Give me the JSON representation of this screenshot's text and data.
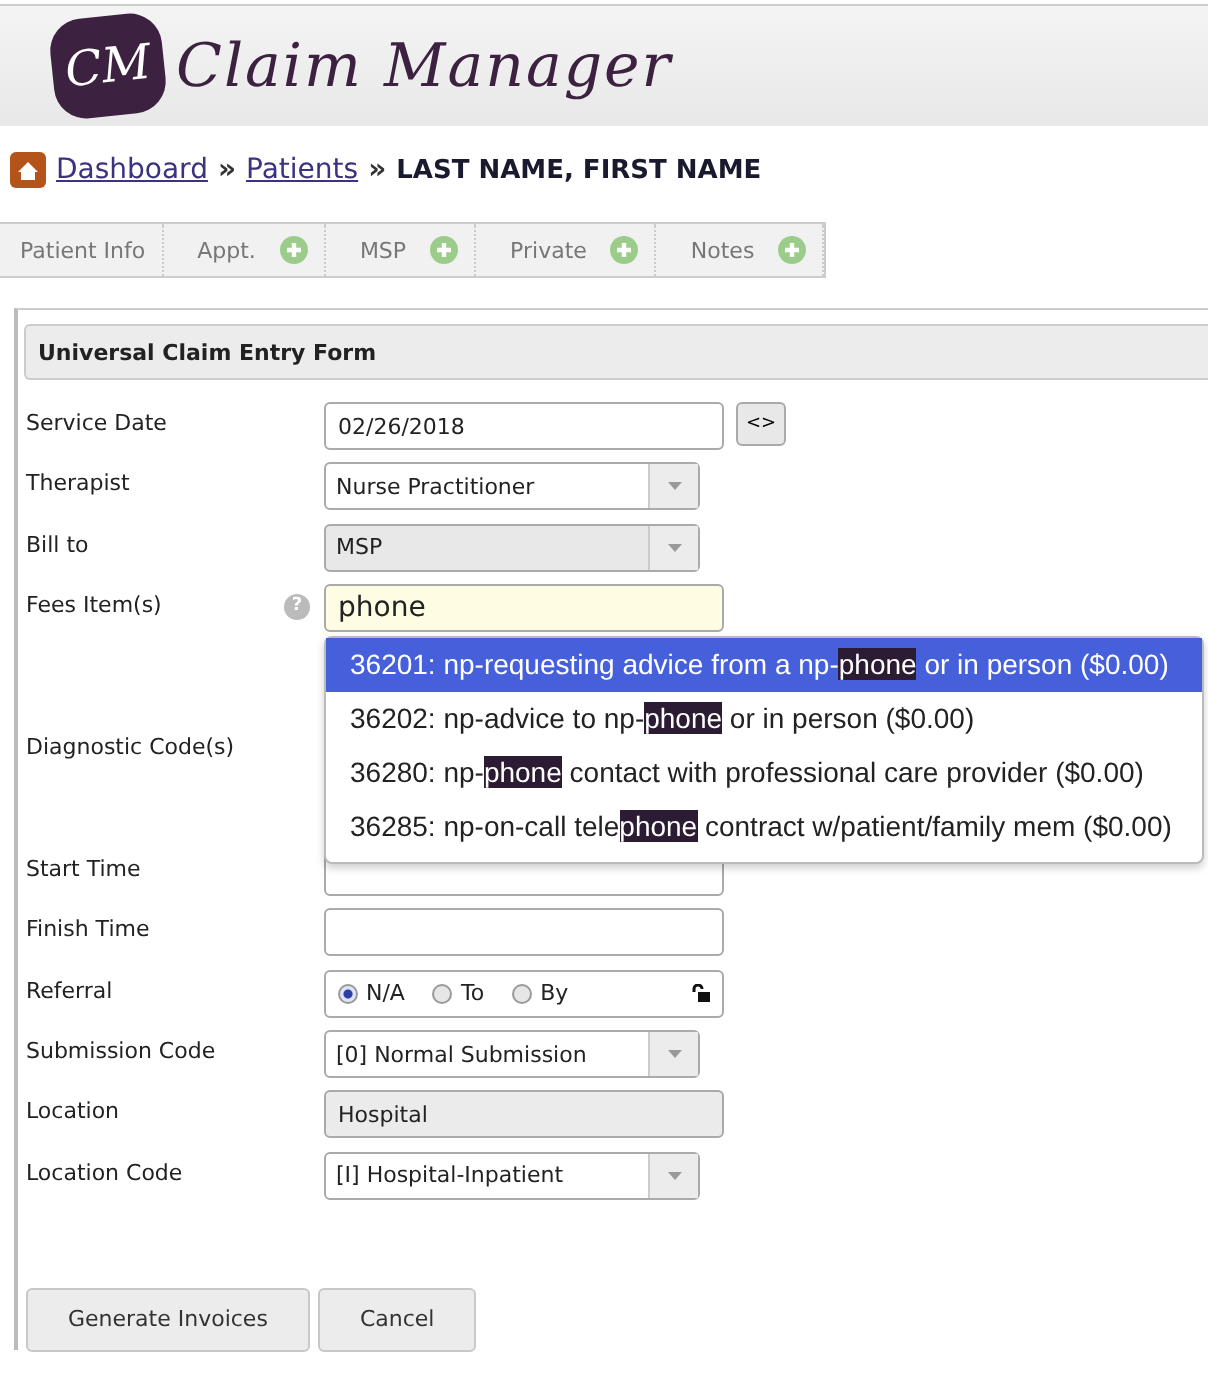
{
  "header": {
    "logo_mark": "CM",
    "title": "Claim Manager"
  },
  "breadcrumb": {
    "links": [
      "Dashboard",
      "Patients"
    ],
    "separators": [
      "»",
      "»"
    ],
    "current": "LAST NAME, FIRST NAME"
  },
  "tabs": [
    {
      "label": "Patient Info",
      "add_button": false
    },
    {
      "label": "Appt.",
      "add_button": true
    },
    {
      "label": "MSP",
      "add_button": true
    },
    {
      "label": "Private",
      "add_button": true
    },
    {
      "label": "Notes",
      "add_button": true
    }
  ],
  "form": {
    "title": "Universal Claim Entry Form",
    "fields": [
      {
        "kind": "date",
        "label": "Service Date",
        "value": "02/26/2018",
        "button": "<>"
      },
      {
        "kind": "select",
        "label": "Therapist",
        "value": "Nurse Practitioner",
        "disabled": false
      },
      {
        "kind": "select",
        "label": "Bill to",
        "value": "MSP",
        "disabled": true
      },
      {
        "kind": "text",
        "label": "Fees Item(s)",
        "value": "phone",
        "help": "?",
        "focused": true,
        "readonly": false
      },
      {
        "kind": "code",
        "label": "Diagnostic Code(s)"
      },
      {
        "kind": "text",
        "label": "Start Time",
        "focused": false,
        "readonly": false
      },
      {
        "kind": "text",
        "label": "Finish Time",
        "focused": false,
        "readonly": false
      },
      {
        "kind": "radio",
        "label": "Referral",
        "options": [
          {
            "label": "N/A",
            "selected": true
          },
          {
            "label": "To",
            "selected": false
          },
          {
            "label": "By",
            "selected": false
          }
        ]
      },
      {
        "kind": "select",
        "label": "Submission Code",
        "value": "[0] Normal Submission",
        "disabled": false
      },
      {
        "kind": "text",
        "label": "Location",
        "value": "Hospital",
        "focused": false,
        "readonly": true
      },
      {
        "kind": "select",
        "label": "Location Code",
        "value": "[I] Hospital-Inpatient",
        "disabled": false
      }
    ],
    "suggestions": [
      {
        "text": "36201: np-requesting advice from a np-**phone** or in person ($0.00)",
        "selected": true
      },
      {
        "text": "36202: np-advice to np-**phone** or in person ($0.00)",
        "selected": false
      },
      {
        "text": "36280: np-**phone** contact with professional care provider ($0.00)",
        "selected": false
      },
      {
        "text": "36285: np-on-call tele**phone** contract w/patient/family mem ($0.00)",
        "selected": false
      }
    ],
    "buttons": [
      "Generate Invoices",
      "Cancel"
    ]
  }
}
